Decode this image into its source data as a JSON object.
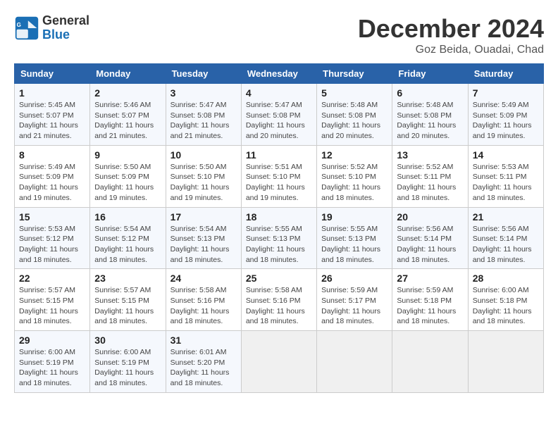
{
  "logo": {
    "line1": "General",
    "line2": "Blue"
  },
  "title": "December 2024",
  "location": "Goz Beida, Ouadai, Chad",
  "weekdays": [
    "Sunday",
    "Monday",
    "Tuesday",
    "Wednesday",
    "Thursday",
    "Friday",
    "Saturday"
  ],
  "weeks": [
    [
      {
        "day": "1",
        "info": "Sunrise: 5:45 AM\nSunset: 5:07 PM\nDaylight: 11 hours\nand 21 minutes."
      },
      {
        "day": "2",
        "info": "Sunrise: 5:46 AM\nSunset: 5:07 PM\nDaylight: 11 hours\nand 21 minutes."
      },
      {
        "day": "3",
        "info": "Sunrise: 5:47 AM\nSunset: 5:08 PM\nDaylight: 11 hours\nand 21 minutes."
      },
      {
        "day": "4",
        "info": "Sunrise: 5:47 AM\nSunset: 5:08 PM\nDaylight: 11 hours\nand 20 minutes."
      },
      {
        "day": "5",
        "info": "Sunrise: 5:48 AM\nSunset: 5:08 PM\nDaylight: 11 hours\nand 20 minutes."
      },
      {
        "day": "6",
        "info": "Sunrise: 5:48 AM\nSunset: 5:08 PM\nDaylight: 11 hours\nand 20 minutes."
      },
      {
        "day": "7",
        "info": "Sunrise: 5:49 AM\nSunset: 5:09 PM\nDaylight: 11 hours\nand 19 minutes."
      }
    ],
    [
      {
        "day": "8",
        "info": "Sunrise: 5:49 AM\nSunset: 5:09 PM\nDaylight: 11 hours\nand 19 minutes."
      },
      {
        "day": "9",
        "info": "Sunrise: 5:50 AM\nSunset: 5:09 PM\nDaylight: 11 hours\nand 19 minutes."
      },
      {
        "day": "10",
        "info": "Sunrise: 5:50 AM\nSunset: 5:10 PM\nDaylight: 11 hours\nand 19 minutes."
      },
      {
        "day": "11",
        "info": "Sunrise: 5:51 AM\nSunset: 5:10 PM\nDaylight: 11 hours\nand 19 minutes."
      },
      {
        "day": "12",
        "info": "Sunrise: 5:52 AM\nSunset: 5:10 PM\nDaylight: 11 hours\nand 18 minutes."
      },
      {
        "day": "13",
        "info": "Sunrise: 5:52 AM\nSunset: 5:11 PM\nDaylight: 11 hours\nand 18 minutes."
      },
      {
        "day": "14",
        "info": "Sunrise: 5:53 AM\nSunset: 5:11 PM\nDaylight: 11 hours\nand 18 minutes."
      }
    ],
    [
      {
        "day": "15",
        "info": "Sunrise: 5:53 AM\nSunset: 5:12 PM\nDaylight: 11 hours\nand 18 minutes."
      },
      {
        "day": "16",
        "info": "Sunrise: 5:54 AM\nSunset: 5:12 PM\nDaylight: 11 hours\nand 18 minutes."
      },
      {
        "day": "17",
        "info": "Sunrise: 5:54 AM\nSunset: 5:13 PM\nDaylight: 11 hours\nand 18 minutes."
      },
      {
        "day": "18",
        "info": "Sunrise: 5:55 AM\nSunset: 5:13 PM\nDaylight: 11 hours\nand 18 minutes."
      },
      {
        "day": "19",
        "info": "Sunrise: 5:55 AM\nSunset: 5:13 PM\nDaylight: 11 hours\nand 18 minutes."
      },
      {
        "day": "20",
        "info": "Sunrise: 5:56 AM\nSunset: 5:14 PM\nDaylight: 11 hours\nand 18 minutes."
      },
      {
        "day": "21",
        "info": "Sunrise: 5:56 AM\nSunset: 5:14 PM\nDaylight: 11 hours\nand 18 minutes."
      }
    ],
    [
      {
        "day": "22",
        "info": "Sunrise: 5:57 AM\nSunset: 5:15 PM\nDaylight: 11 hours\nand 18 minutes."
      },
      {
        "day": "23",
        "info": "Sunrise: 5:57 AM\nSunset: 5:15 PM\nDaylight: 11 hours\nand 18 minutes."
      },
      {
        "day": "24",
        "info": "Sunrise: 5:58 AM\nSunset: 5:16 PM\nDaylight: 11 hours\nand 18 minutes."
      },
      {
        "day": "25",
        "info": "Sunrise: 5:58 AM\nSunset: 5:16 PM\nDaylight: 11 hours\nand 18 minutes."
      },
      {
        "day": "26",
        "info": "Sunrise: 5:59 AM\nSunset: 5:17 PM\nDaylight: 11 hours\nand 18 minutes."
      },
      {
        "day": "27",
        "info": "Sunrise: 5:59 AM\nSunset: 5:18 PM\nDaylight: 11 hours\nand 18 minutes."
      },
      {
        "day": "28",
        "info": "Sunrise: 6:00 AM\nSunset: 5:18 PM\nDaylight: 11 hours\nand 18 minutes."
      }
    ],
    [
      {
        "day": "29",
        "info": "Sunrise: 6:00 AM\nSunset: 5:19 PM\nDaylight: 11 hours\nand 18 minutes."
      },
      {
        "day": "30",
        "info": "Sunrise: 6:00 AM\nSunset: 5:19 PM\nDaylight: 11 hours\nand 18 minutes."
      },
      {
        "day": "31",
        "info": "Sunrise: 6:01 AM\nSunset: 5:20 PM\nDaylight: 11 hours\nand 18 minutes."
      },
      null,
      null,
      null,
      null
    ]
  ]
}
